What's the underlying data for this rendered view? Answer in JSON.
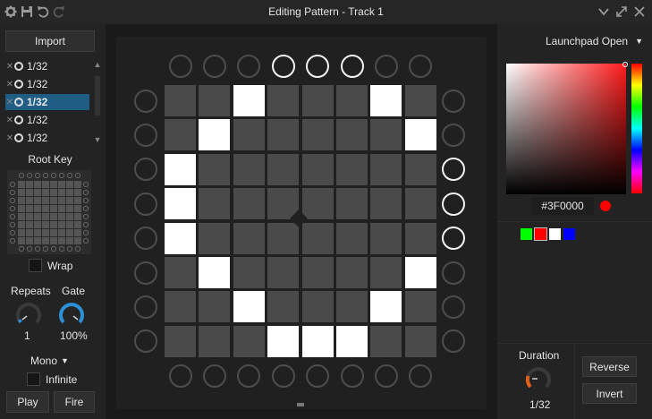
{
  "window": {
    "title": "Editing Pattern - Track 1"
  },
  "left": {
    "import_label": "Import",
    "frames": [
      {
        "label": "1/32",
        "selected": false
      },
      {
        "label": "1/32",
        "selected": false
      },
      {
        "label": "1/32",
        "selected": true
      },
      {
        "label": "1/32",
        "selected": false
      },
      {
        "label": "1/32",
        "selected": false
      }
    ],
    "root_key_label": "Root Key",
    "wrap_label": "Wrap",
    "repeats_label": "Repeats",
    "gate_label": "Gate",
    "repeats_value": "1",
    "gate_value": "100%",
    "mode_label": "Mono",
    "infinite_label": "Infinite",
    "play_label": "Play",
    "fire_label": "Fire"
  },
  "launchpad": {
    "top_row_lit": [
      false,
      false,
      false,
      true,
      true,
      true,
      false,
      false
    ],
    "left_col_lit": [
      false,
      false,
      false,
      false,
      false,
      false,
      false,
      false
    ],
    "right_col_lit": [
      false,
      false,
      true,
      true,
      true,
      false,
      false,
      false
    ],
    "bottom_row_lit": [
      false,
      false,
      false,
      false,
      false,
      false,
      false,
      false
    ],
    "grid": [
      [
        0,
        0,
        1,
        0,
        0,
        0,
        1,
        0
      ],
      [
        0,
        1,
        0,
        0,
        0,
        0,
        0,
        1
      ],
      [
        1,
        0,
        0,
        0,
        0,
        0,
        0,
        0
      ],
      [
        1,
        0,
        0,
        0,
        0,
        0,
        0,
        0
      ],
      [
        1,
        0,
        0,
        0,
        0,
        0,
        0,
        0
      ],
      [
        0,
        1,
        0,
        0,
        0,
        0,
        0,
        1
      ],
      [
        0,
        0,
        1,
        0,
        0,
        0,
        1,
        0
      ],
      [
        0,
        0,
        0,
        1,
        1,
        1,
        0,
        0
      ]
    ],
    "on_color": "#ffffff",
    "off_color": "#4a4a4a"
  },
  "right": {
    "device_label": "Launchpad Open",
    "hex_value": "#3F0000",
    "swatches": [
      "#00ff00",
      "#ff0000",
      "#ffffff",
      "#0000ff"
    ],
    "selected_swatch": 1,
    "duration_label": "Duration",
    "duration_value": "1/32",
    "reverse_label": "Reverse",
    "invert_label": "Invert"
  }
}
